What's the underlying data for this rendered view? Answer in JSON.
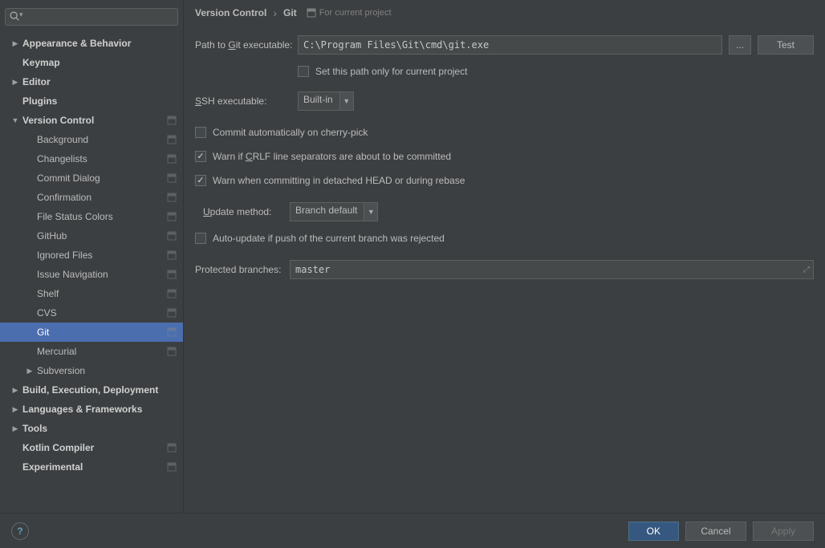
{
  "search": {
    "placeholder": ""
  },
  "sidebar": {
    "items": [
      {
        "label": "Appearance & Behavior",
        "depth": 0,
        "arrow": "right",
        "bold": true,
        "project": false
      },
      {
        "label": "Keymap",
        "depth": 0,
        "arrow": null,
        "bold": true,
        "project": false
      },
      {
        "label": "Editor",
        "depth": 0,
        "arrow": "right",
        "bold": true,
        "project": false
      },
      {
        "label": "Plugins",
        "depth": 0,
        "arrow": null,
        "bold": true,
        "project": false
      },
      {
        "label": "Version Control",
        "depth": 0,
        "arrow": "down",
        "bold": true,
        "project": true
      },
      {
        "label": "Background",
        "depth": 1,
        "arrow": null,
        "bold": false,
        "project": true
      },
      {
        "label": "Changelists",
        "depth": 1,
        "arrow": null,
        "bold": false,
        "project": true
      },
      {
        "label": "Commit Dialog",
        "depth": 1,
        "arrow": null,
        "bold": false,
        "project": true
      },
      {
        "label": "Confirmation",
        "depth": 1,
        "arrow": null,
        "bold": false,
        "project": true
      },
      {
        "label": "File Status Colors",
        "depth": 1,
        "arrow": null,
        "bold": false,
        "project": true
      },
      {
        "label": "GitHub",
        "depth": 1,
        "arrow": null,
        "bold": false,
        "project": true
      },
      {
        "label": "Ignored Files",
        "depth": 1,
        "arrow": null,
        "bold": false,
        "project": true
      },
      {
        "label": "Issue Navigation",
        "depth": 1,
        "arrow": null,
        "bold": false,
        "project": true
      },
      {
        "label": "Shelf",
        "depth": 1,
        "arrow": null,
        "bold": false,
        "project": true
      },
      {
        "label": "CVS",
        "depth": 1,
        "arrow": null,
        "bold": false,
        "project": true
      },
      {
        "label": "Git",
        "depth": 1,
        "arrow": null,
        "bold": false,
        "project": true,
        "selected": true
      },
      {
        "label": "Mercurial",
        "depth": 1,
        "arrow": null,
        "bold": false,
        "project": true
      },
      {
        "label": "Subversion",
        "depth": 1,
        "arrow": "right",
        "bold": false,
        "project": false
      },
      {
        "label": "Build, Execution, Deployment",
        "depth": 0,
        "arrow": "right",
        "bold": true,
        "project": false
      },
      {
        "label": "Languages & Frameworks",
        "depth": 0,
        "arrow": "right",
        "bold": true,
        "project": false
      },
      {
        "label": "Tools",
        "depth": 0,
        "arrow": "right",
        "bold": true,
        "project": false
      },
      {
        "label": "Kotlin Compiler",
        "depth": 0,
        "arrow": null,
        "bold": true,
        "project": true
      },
      {
        "label": "Experimental",
        "depth": 0,
        "arrow": null,
        "bold": true,
        "project": true
      }
    ]
  },
  "header": {
    "crumb1": "Version Control",
    "crumb2": "Git",
    "for_project": "For current project"
  },
  "form": {
    "path_label_pre": "Path to ",
    "path_label_mn": "G",
    "path_label_post": "it executable:",
    "path_value": "C:\\Program Files\\Git\\cmd\\git.exe",
    "browse": "...",
    "test": "Test",
    "set_path_only": "Set this path only for current project",
    "ssh_label_pre": "",
    "ssh_label_mn": "S",
    "ssh_label_post": "SH executable:",
    "ssh_value": "Built-in",
    "cb_cherrypick": "Commit automatically on cherry-pick",
    "cb_crlf_pre": "Warn if ",
    "cb_crlf_mn": "C",
    "cb_crlf_post": "RLF line separators are about to be committed",
    "cb_detached": "Warn when committing in detached HEAD or during rebase",
    "update_label_pre": "",
    "update_label_mn": "U",
    "update_label_post": "pdate method:",
    "update_value": "Branch default",
    "cb_autoupdate": "Auto-update if push of the current branch was rejected",
    "protected_label": "Protected branches:",
    "protected_value": "master"
  },
  "buttons": {
    "ok": "OK",
    "cancel": "Cancel",
    "apply": "Apply"
  }
}
